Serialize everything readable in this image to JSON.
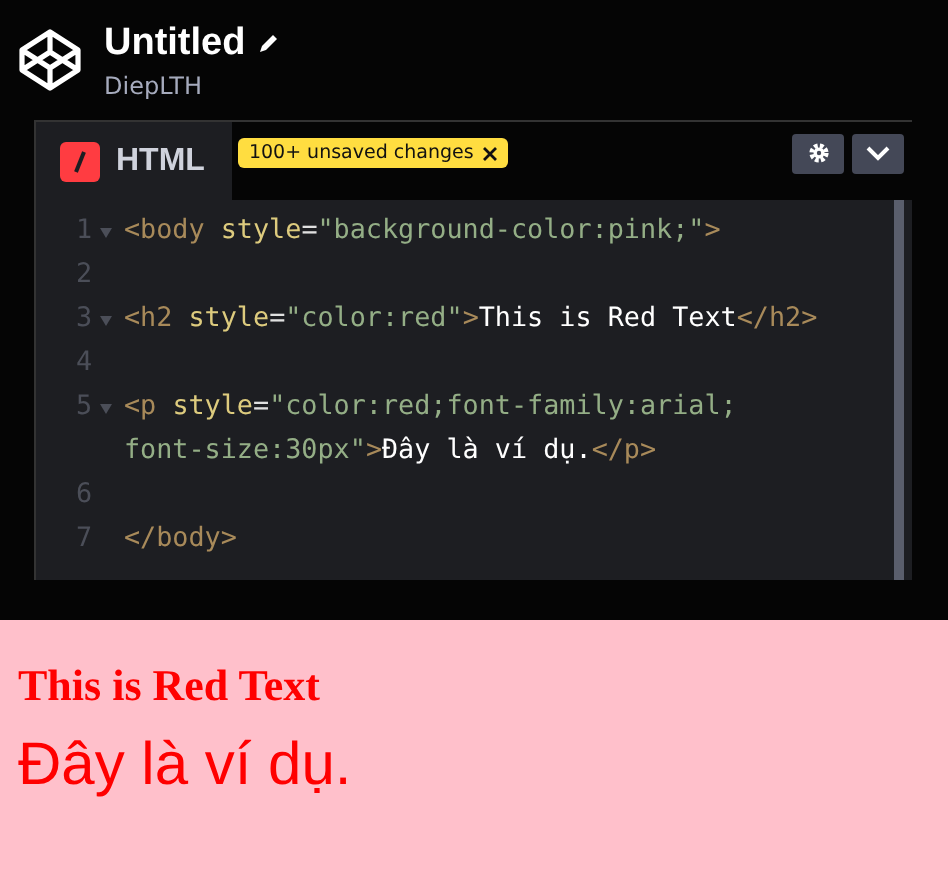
{
  "header": {
    "title": "Untitled",
    "author": "DiepLTH"
  },
  "editor": {
    "tab": {
      "label": "HTML",
      "selected": true
    },
    "badge": "100+ unsaved changes",
    "lines": [
      {
        "number": "1",
        "foldable": true,
        "segments": [
          {
            "kind": "tag",
            "text": "<body "
          },
          {
            "kind": "attr",
            "text": "style"
          },
          {
            "kind": "punct",
            "text": "="
          },
          {
            "kind": "string",
            "text": "\"background-color:pink;\""
          },
          {
            "kind": "tag",
            "text": ">"
          }
        ]
      },
      {
        "number": "2",
        "foldable": false
      },
      {
        "number": "3",
        "foldable": true,
        "segments": [
          {
            "kind": "tag",
            "text": "<h2 "
          },
          {
            "kind": "attr",
            "text": "style"
          },
          {
            "kind": "punct",
            "text": "="
          },
          {
            "kind": "string",
            "text": "\"color:red\""
          },
          {
            "kind": "tag",
            "text": ">"
          },
          {
            "kind": "text",
            "text": "This is Red Text"
          },
          {
            "kind": "tag",
            "text": "</h2>"
          }
        ]
      },
      {
        "number": "4",
        "foldable": false
      },
      {
        "number": "5",
        "foldable": true,
        "segments": [
          {
            "kind": "tag",
            "text": "<p "
          },
          {
            "kind": "attr",
            "text": "style"
          },
          {
            "kind": "punct",
            "text": "="
          },
          {
            "kind": "string",
            "text": "\"color:red;font-family:arial; font-size:30px\""
          },
          {
            "kind": "tag",
            "text": ">"
          },
          {
            "kind": "text",
            "text": "Đây là ví dụ."
          },
          {
            "kind": "tag",
            "text": "</p>"
          }
        ]
      },
      {
        "number": "6",
        "foldable": false
      },
      {
        "number": "7",
        "foldable": false,
        "segments": [
          {
            "kind": "tag",
            "text": "</body>"
          }
        ]
      }
    ]
  },
  "preview": {
    "heading": "This is Red Text",
    "paragraph": "Đây là ví dụ."
  }
}
